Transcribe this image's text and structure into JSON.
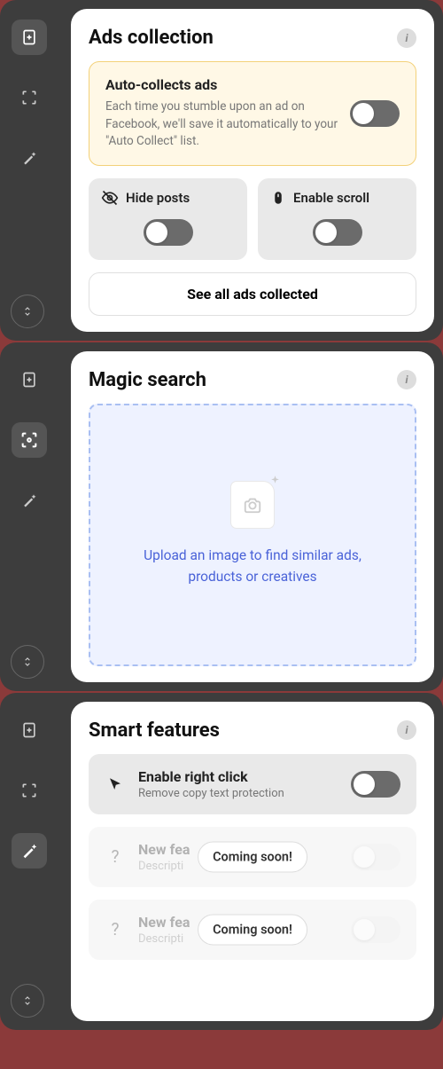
{
  "panels": {
    "ads": {
      "title": "Ads collection",
      "hero": {
        "title": "Auto-collects ads",
        "desc": "Each time you stumble upon an ad on Facebook, we'll save it automatically to your \"Auto Collect\" list."
      },
      "opts": {
        "hide": "Hide posts",
        "scroll": "Enable scroll"
      },
      "see_all": "See all ads collected"
    },
    "magic": {
      "title": "Magic search",
      "drop": "Upload an image to find similar ads, products or creatives"
    },
    "smart": {
      "title": "Smart features",
      "right_click": {
        "title": "Enable right click",
        "desc": "Remove copy text protection"
      },
      "soon": [
        {
          "title": "New fea",
          "desc": "Descripti",
          "badge": "Coming soon!"
        },
        {
          "title": "New fea",
          "desc": "Descripti",
          "badge": "Coming soon!"
        }
      ]
    }
  }
}
